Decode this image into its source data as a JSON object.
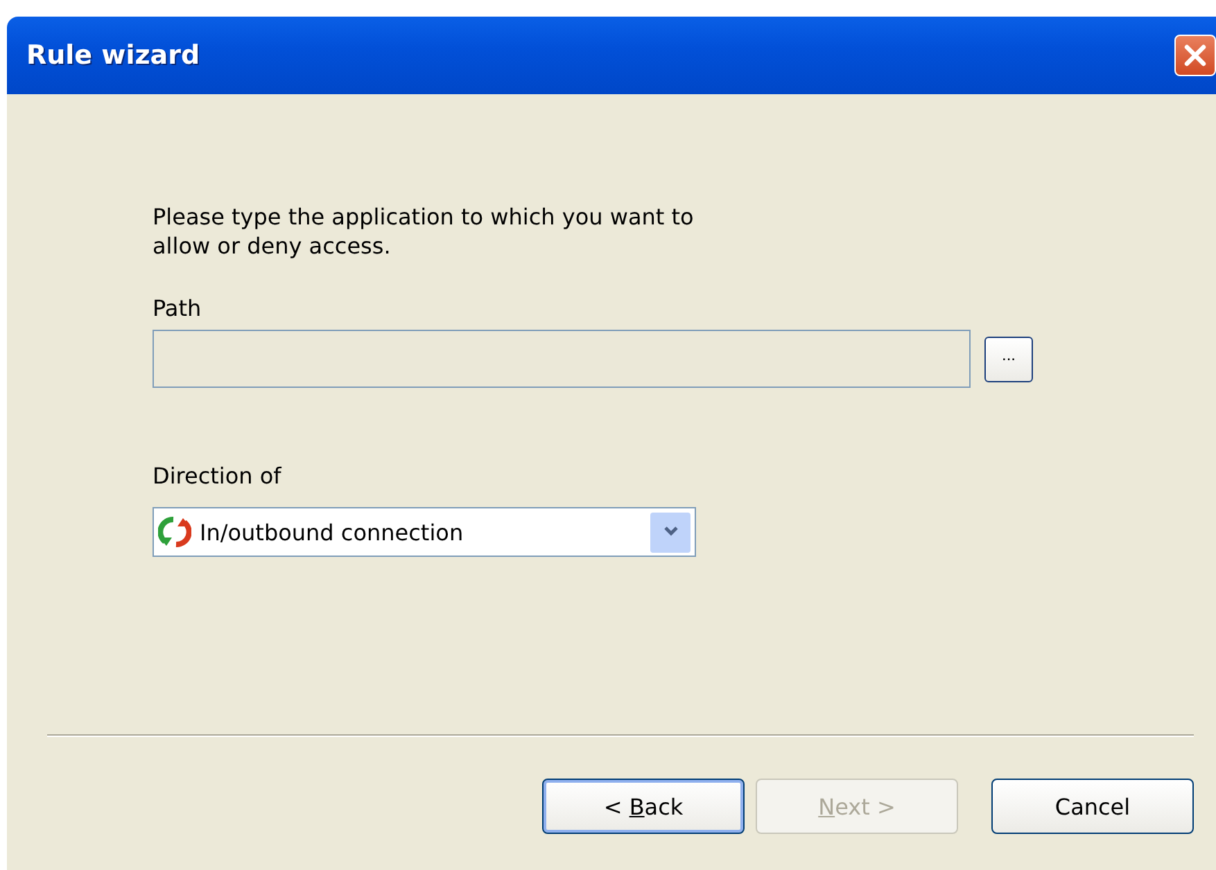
{
  "window": {
    "title": "Rule wizard"
  },
  "instruction": "Please type the application to which you want to allow or deny access.",
  "path": {
    "label": "Path",
    "disabled": true,
    "browse_label": "..."
  },
  "direction": {
    "label": "Direction of",
    "value": "In/outbound connection"
  },
  "buttons": [
    {
      "kind": "back",
      "before": "< ",
      "access_key": "B",
      "after": "ack",
      "disabled": false,
      "default": true
    },
    {
      "kind": "next",
      "access_key": "N",
      "after": "ext >",
      "disabled": true,
      "default": false
    },
    {
      "kind": "cancel",
      "before": "Cancel",
      "disabled": false,
      "default": false
    }
  ]
}
